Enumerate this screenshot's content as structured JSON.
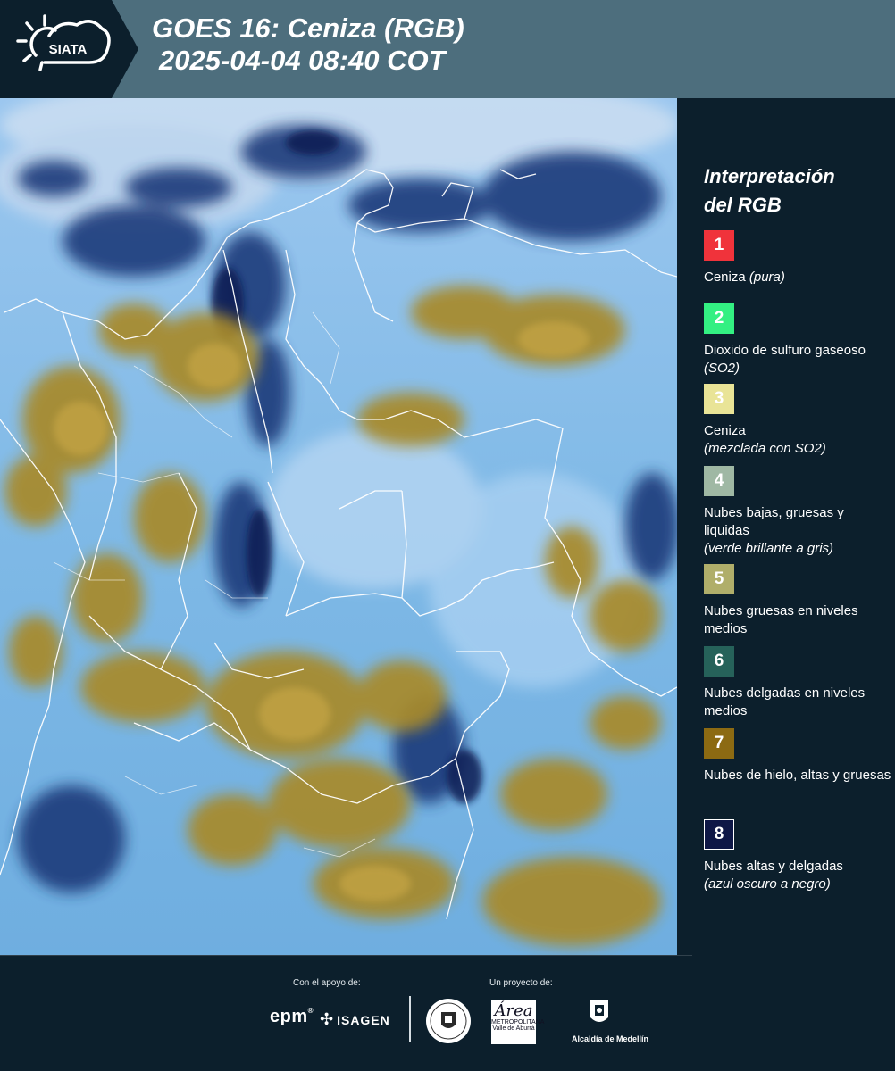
{
  "header": {
    "brand": "SIATA",
    "title_line1": "GOES 16: Ceniza (RGB)",
    "title_line2": "2025-04-04 08:40 COT"
  },
  "legend": {
    "title_line1": "Interpretación",
    "title_line2": "del RGB",
    "items": [
      {
        "number": "1",
        "color": "#f0333b",
        "label": "Ceniza",
        "label_italic": "(pura)",
        "italic_inline": true
      },
      {
        "number": "2",
        "color": "#33f082",
        "label": "Dioxido de sulfuro gaseoso",
        "label_italic": "(SO2)",
        "italic_inline": true
      },
      {
        "number": "3",
        "color": "#e9e497",
        "label": "Ceniza",
        "label_italic": "(mezclada con SO2)",
        "italic_inline": false
      },
      {
        "number": "4",
        "color": "#9fb8a4",
        "label": "Nubes bajas, gruesas y liquidas",
        "label_italic": "(verde brillante a gris)",
        "italic_inline": false
      },
      {
        "number": "5",
        "color": "#b0ae6a",
        "label": "Nubes gruesas en niveles medios",
        "label_italic": "",
        "italic_inline": false
      },
      {
        "number": "6",
        "color": "#26625a",
        "label": "Nubes delgadas en niveles medios",
        "label_italic": "",
        "italic_inline": false
      },
      {
        "number": "7",
        "color": "#8c6a12",
        "label": "Nubes de hielo, altas y gruesas",
        "label_italic": "",
        "italic_inline": false
      },
      {
        "number": "8",
        "color": "#0e1746",
        "label": "Nubes altas y delgadas",
        "label_italic": "(azul oscuro a negro)",
        "italic_inline": false
      }
    ]
  },
  "footer": {
    "support_label": "Con el apoyo de:",
    "project_label": "Un proyecto de:",
    "sponsors": [
      "epm",
      "ISAGEN"
    ],
    "partners": [
      "Área Metropolitana Valle de Aburrá",
      "Alcaldía de Medellín"
    ],
    "area_logo_text": "Área",
    "area_logo_sub": "METROPOLITANA",
    "area_logo_sub2": "Valle de Aburrá",
    "medellin_text": "Alcaldía de Medellín"
  },
  "colors": {
    "header_bg": "#4d6e7d",
    "page_bg": "#0c1f2c",
    "cloud_light_blue": "#7fb9e8",
    "cloud_ochre": "#a88a2a",
    "cloud_dark": "#0e1746"
  }
}
